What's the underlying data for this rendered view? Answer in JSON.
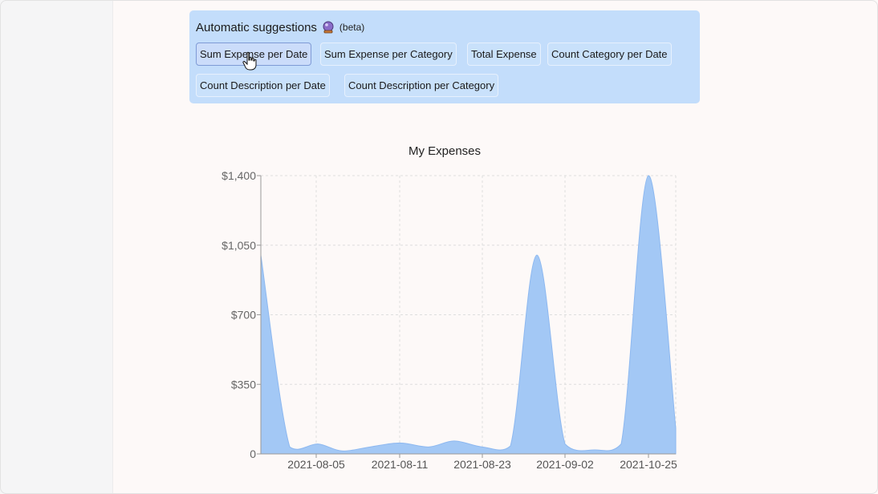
{
  "suggestions": {
    "title": "Automatic suggestions",
    "badge": "(beta)",
    "icon": "crystal-ball-icon",
    "chips": [
      {
        "label": "Sum Expense per Date"
      },
      {
        "label": "Sum Expense per Category"
      },
      {
        "label": "Total Expense"
      },
      {
        "label": "Count Category per Date"
      },
      {
        "label": "Count Description per Date"
      },
      {
        "label": "Count Description per Category"
      }
    ],
    "active_chip": "Sum Expense per Date"
  },
  "colors": {
    "panel_bg": "#c3ddfb",
    "area_fill": "#a3c8f5",
    "area_stroke": "#8db8f0"
  },
  "chart_data": {
    "type": "area",
    "title": "My Expenses",
    "xlabel": "",
    "ylabel": "",
    "ylim": [
      0,
      1400
    ],
    "y_ticks": [
      "0",
      "$350",
      "$700",
      "$1,050",
      "$1,400"
    ],
    "x_tick_labels": [
      "2021-08-05",
      "2021-08-11",
      "2021-08-23",
      "2021-09-02",
      "2021-10-25"
    ],
    "grid": true,
    "series": [
      {
        "values": [
          1000,
          35,
          50,
          15,
          35,
          55,
          35,
          65,
          35,
          40,
          1000,
          50,
          20,
          50,
          1400,
          130
        ]
      }
    ]
  }
}
